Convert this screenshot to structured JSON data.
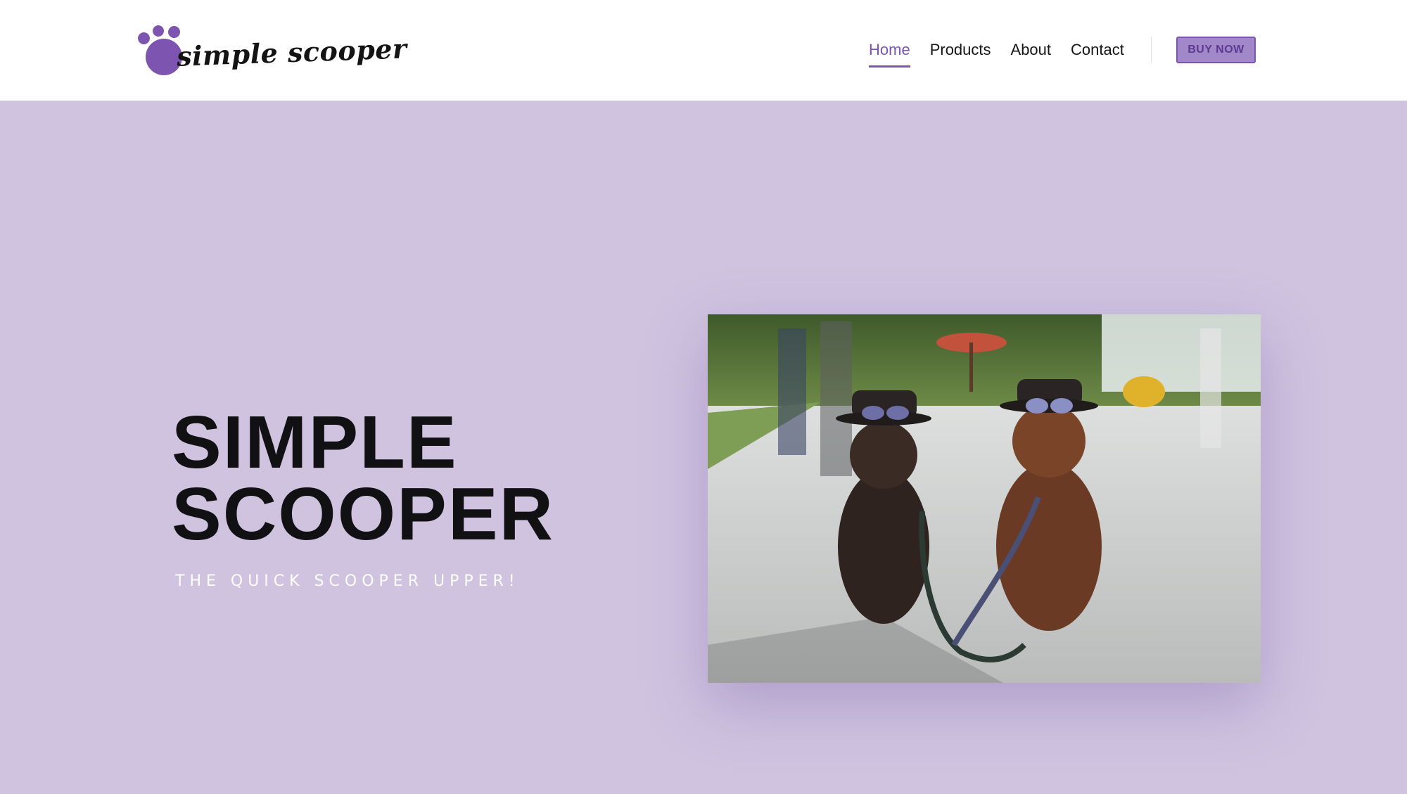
{
  "brand": {
    "logo_text": "simple scooper",
    "logo_icon": "paw-icon",
    "accent_color": "#7d55b0"
  },
  "nav": {
    "items": [
      {
        "label": "Home",
        "active": true
      },
      {
        "label": "Products",
        "active": false
      },
      {
        "label": "About",
        "active": false
      },
      {
        "label": "Contact",
        "active": false
      }
    ],
    "cta_label": "BUY NOW"
  },
  "hero": {
    "title_line1": "SIMPLE",
    "title_line2": "SCOOPER",
    "subtitle": "THE QUICK SCOOPER UPPER!",
    "background_color": "#cfc3e0",
    "image_alt": "two poodles wearing hats and sunglasses sitting on a sidewalk"
  }
}
